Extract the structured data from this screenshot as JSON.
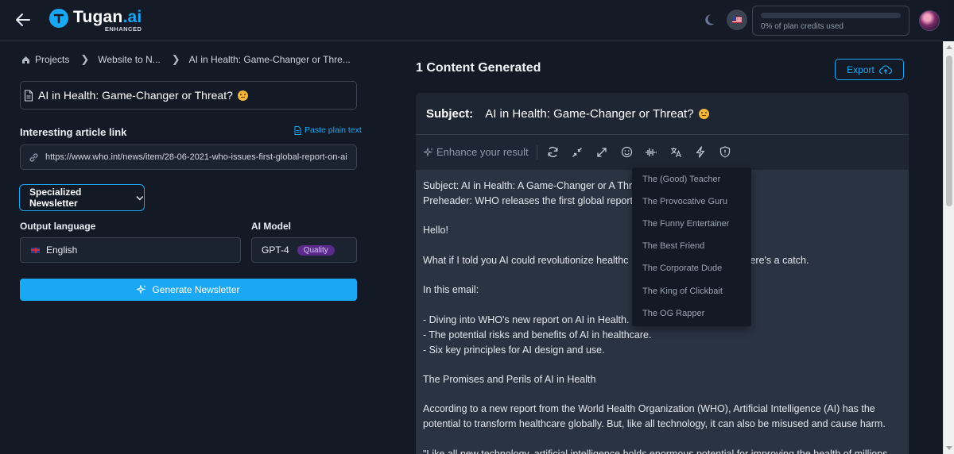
{
  "header": {
    "logo_name": "Tugan",
    "logo_ai": ".ai",
    "logo_sub": "ENHANCED",
    "credits_text": "0% of plan credits used",
    "credits_used_fraction": 0.0
  },
  "breadcrumb": {
    "home": "Projects",
    "second": "Website to N...",
    "third": "AI in Health: Game-Changer or Thre..."
  },
  "form": {
    "title_value": "AI in Health: Game-Changer or Threat?",
    "article_label": "Interesting article link",
    "paste_link": "Paste plain text",
    "url_value": "https://www.who.int/news/item/28-06-2021-who-issues-first-global-report-on-ai",
    "type_value": "Specialized Newsletter",
    "language_label": "Output language",
    "language_value": "English",
    "model_label": "AI Model",
    "model_value": "GPT-4",
    "model_badge": "Quality",
    "generate_label": "Generate Newsletter"
  },
  "result": {
    "heading": "1 Content Generated",
    "export_label": "Export",
    "subject_key": "Subject:",
    "subject_value": "AI in Health: Game-Changer or Threat?",
    "enhance_label": "Enhance your result",
    "body": {
      "line1": "Subject: AI in Health: A Game-Changer or A Thre",
      "line2": "Preheader: WHO releases the first global report",
      "hello": "Hello!",
      "para1a": "What if I told you AI could revolutionize healthc",
      "para1b": "ere's a catch.",
      "in_email": "In this email:",
      "bullet1": "- Diving into WHO's new report on AI in Health.",
      "bullet2": "- The potential risks and benefits of AI in healthcare.",
      "bullet3": "- Six key principles for AI design and use.",
      "section": "The Promises and Perils of AI in Health",
      "para2a": "According to a new report from the World Health Organization (WHO), Artificial Intelligence (AI) has the",
      "para2b": "potential to transform healthcare globally. But, like all technology, it can also be misused and cause harm.",
      "quote": "\"Like all new technology, artificial intelligence holds enormous potential for improving the health of millions"
    }
  },
  "tone_menu": [
    "The (Good) Teacher",
    "The Provocative Guru",
    "The Funny Entertainer",
    "The Best Friend",
    "The Corporate Dude",
    "The King of Clickbait",
    "The OG Rapper"
  ],
  "colors": {
    "accent": "#1aa8f5",
    "background": "#131a26",
    "card": "#2a3342",
    "badge": "#5b2b8c"
  },
  "icons": [
    "back-arrow-icon",
    "logo-t-icon",
    "moon-icon",
    "us-flag-icon",
    "home-icon",
    "chevron-right-icon",
    "document-icon",
    "link-icon",
    "chevron-down-icon",
    "sparkles-icon",
    "cloud-upload-icon",
    "refresh-icon",
    "shorten-icon",
    "expand-icon",
    "smile-icon",
    "voice-icon",
    "translate-icon",
    "lightning-icon",
    "shield-icon"
  ]
}
